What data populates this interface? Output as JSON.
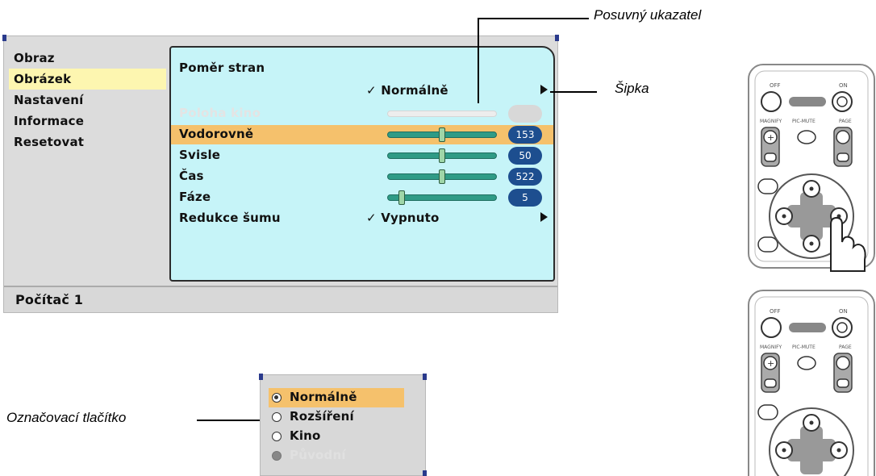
{
  "osd": {
    "menu": [
      {
        "label": "Obraz",
        "selected": false
      },
      {
        "label": "Obrázek",
        "selected": true
      },
      {
        "label": "Nastavení",
        "selected": false
      },
      {
        "label": "Informace",
        "selected": false
      },
      {
        "label": "Resetovat",
        "selected": false
      }
    ],
    "panel": {
      "aspect_label": "Poměr stran",
      "aspect_value": "✓ Normálně",
      "rows": [
        {
          "label": "Poloha kino",
          "disabled": true,
          "value": null,
          "level": null
        },
        {
          "label": "Vodorovně",
          "highlighted": true,
          "value": "153",
          "level": 0.5
        },
        {
          "label": "Svisle",
          "value": "50",
          "level": 0.5
        },
        {
          "label": "Čas",
          "value": "522",
          "level": 0.5
        },
        {
          "label": "Fáze",
          "value": "5",
          "level": 0.1
        }
      ],
      "noise_label": "Redukce šumu",
      "noise_value": "✓ Vypnuto"
    },
    "status": "Počítač 1"
  },
  "callouts": {
    "slider": "Posuvný ukazatel",
    "arrow": "Šipka",
    "radio": "Označovací tlačítko"
  },
  "radio_dialog": {
    "options": [
      {
        "label": "Normálně",
        "checked": true,
        "disabled": false
      },
      {
        "label": "Rozšíření",
        "checked": false,
        "disabled": false
      },
      {
        "label": "Kino",
        "checked": false,
        "disabled": false
      },
      {
        "label": "Původní",
        "checked": false,
        "disabled": true
      }
    ]
  },
  "remote": {
    "labels": [
      "OFF",
      "ON",
      "MAGNIFY",
      "PIC-MUTE",
      "PAGE"
    ]
  },
  "colors": {
    "panel_bg": "#c6f4f8",
    "highlight": "#f5c16c",
    "menu_selected": "#fdf6b0",
    "slider": "#2f9b86",
    "badge": "#1d4e8f"
  }
}
